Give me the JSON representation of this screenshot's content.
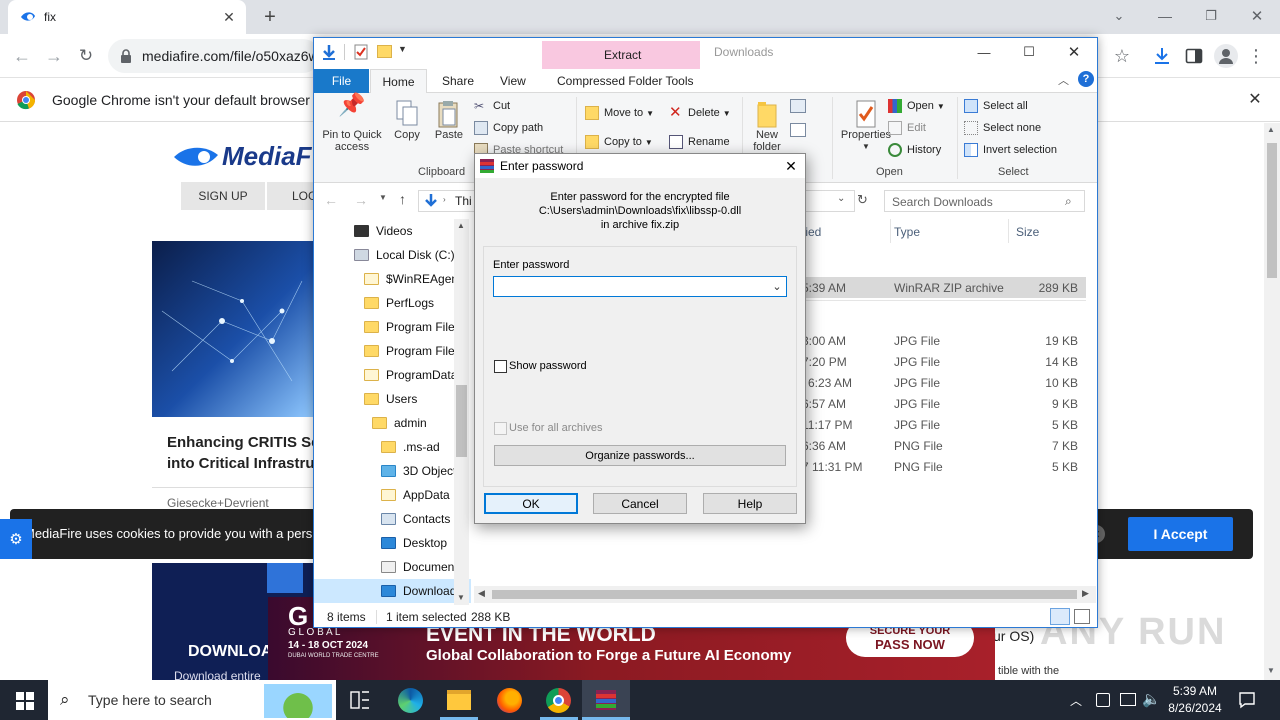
{
  "browser": {
    "tab_title": "fix",
    "new_tab_symbol": "+",
    "url": "mediafire.com/file/o50xaz6w",
    "infobar_text": "Google Chrome isn't your default browser"
  },
  "webpage": {
    "logo_text": "MediaF",
    "nav": {
      "signup": "SIGN UP",
      "login": "LOG"
    },
    "article_title_1": "Enhancing CRITIS Se",
    "article_title_2": "into Critical Infrastru",
    "article_source": "Giesecke+Devrient",
    "cookie_text": "MediaFire uses cookies to provide you with a pers",
    "accept_label": "I Accept",
    "download_label": "DOWNLOA",
    "download_sub": "Download entire",
    "os_text": "ur OS)",
    "compat_text": "tible with the",
    "ad": {
      "brand": "G",
      "global_word": "G L O B A L",
      "dates": "14 - 18 OCT 2024",
      "venue": "DUBAI WORLD TRADE CENTRE",
      "headline": "EVENT IN THE WORLD",
      "subline": "Global Collaboration to Forge a Future AI Economy",
      "cta_top": "SECURE YOUR",
      "cta": "PASS NOW"
    },
    "watermark": "ANY RUN"
  },
  "explorer": {
    "title": "Downloads",
    "contextual_tab": "Extract",
    "tabs": [
      "File",
      "Home",
      "Share",
      "View",
      "Compressed Folder Tools"
    ],
    "clipboard": {
      "pin": "Pin to Quick access",
      "copy": "Copy",
      "paste": "Paste",
      "cut": "Cut",
      "copy_path": "Copy path",
      "paste_shortcut": "Paste shortcut",
      "label": "Clipboard"
    },
    "organize": {
      "move_to": "Move to",
      "copy_to": "Copy to",
      "delete": "Delete",
      "rename": "Rename"
    },
    "new": {
      "new_folder": "New folder"
    },
    "open": {
      "properties": "Properties",
      "open": "Open",
      "edit": "Edit",
      "history": "History",
      "label": "Open"
    },
    "select": {
      "all": "Select all",
      "none": "Select none",
      "invert": "Invert selection",
      "label": "Select"
    },
    "address": "Thi",
    "search_placeholder": "Search Downloads",
    "columns": {
      "modified": "fied",
      "type": "Type",
      "size": "Size"
    },
    "tree": [
      "Videos",
      "Local Disk (C:)",
      "$WinREAgent",
      "PerfLogs",
      "Program Files",
      "Program Files",
      "ProgramData",
      "Users",
      "admin",
      ".ms-ad",
      "3D Objects",
      "AppData",
      "Contacts",
      "Desktop",
      "Document",
      "Download"
    ],
    "files": [
      {
        "date": "5:39 AM",
        "type": "WinRAR ZIP archive",
        "size": "289 KB",
        "selected": true
      },
      {
        "date": "3:00 AM",
        "type": "JPG File",
        "size": "19 KB"
      },
      {
        "date": "7:20 PM",
        "type": "JPG File",
        "size": "14 KB"
      },
      {
        "date": "l 6:23 AM",
        "type": "JPG File",
        "size": "10 KB"
      },
      {
        "date": "6:57 AM",
        "type": "JPG File",
        "size": "9 KB"
      },
      {
        "date": "11:17 PM",
        "type": "JPG File",
        "size": "5 KB"
      },
      {
        "date": "6:36 AM",
        "type": "PNG File",
        "size": "7 KB"
      },
      {
        "date": "7 11:31 PM",
        "type": "PNG File",
        "size": "5 KB"
      }
    ],
    "status": {
      "items": "8 items",
      "selected": "1 item selected",
      "size": "288 KB"
    }
  },
  "dialog": {
    "title": "Enter password",
    "message_line1": "Enter password for the encrypted file",
    "message_line2": "C:\\Users\\admin\\Downloads\\fix\\libssp-0.dll",
    "message_line3": "in archive fix.zip",
    "field_label": "Enter password",
    "field_value": "",
    "show_password": "Show password",
    "use_for_all": "Use for all archives",
    "organize": "Organize passwords...",
    "ok": "OK",
    "cancel": "Cancel",
    "help": "Help"
  },
  "taskbar": {
    "search_placeholder": "Type here to search",
    "time": "5:39 AM",
    "date": "8/26/2024"
  },
  "colors": {
    "accent": "#0078d7",
    "mediafire_blue": "#1a73e8",
    "selection": "#cce8ff",
    "taskbar": "#1f2632",
    "ad_banner": "#7b1622"
  }
}
